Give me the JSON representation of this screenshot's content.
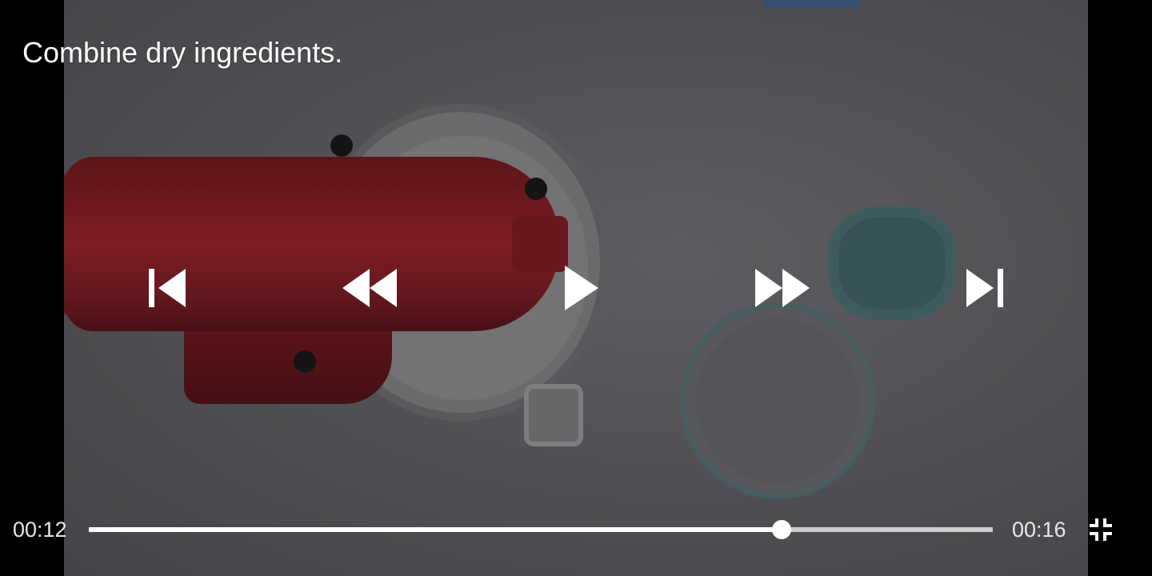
{
  "caption": "Combine dry ingredients.",
  "player": {
    "current_time": "00:12",
    "duration": "00:16",
    "progress": 0.766,
    "controls": {
      "previous": "skip-previous-icon",
      "rewind": "rewind-icon",
      "play": "play-icon",
      "fast_forward": "fast-forward-icon",
      "next": "skip-next-icon",
      "exit_fullscreen": "fullscreen-exit-icon"
    }
  },
  "colors": {
    "icon": "#ffffff",
    "track": "#cfcfcf",
    "fill": "#ffffff",
    "time_text": "#e6e6e6"
  }
}
